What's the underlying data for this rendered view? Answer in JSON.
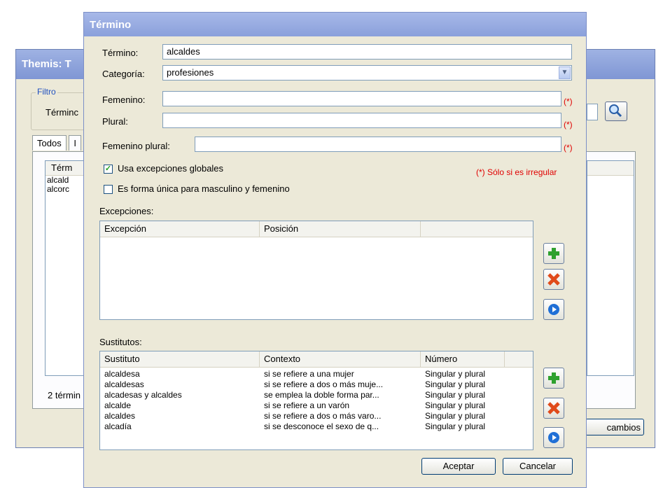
{
  "background_window": {
    "title": "Themis: T",
    "filter_legend": "Filtro",
    "filter_label": "Términc",
    "tabs": [
      "Todos",
      "I"
    ],
    "list_header": "Térm",
    "list_rows": [
      "alcald",
      "alcorc"
    ],
    "count": "2 términ",
    "changes_button": "cambios"
  },
  "dialog": {
    "title": "Término",
    "termino_label": "Término:",
    "termino_value": "alcaldes",
    "categoria_label": "Categoría:",
    "categoria_value": "profesiones",
    "femenino_label": "Femenino:",
    "femenino_value": "",
    "plural_label": "Plural:",
    "plural_value": "",
    "femenino_plural_label": "Femenino plural:",
    "femenino_plural_value": "",
    "required_marker": "(*)",
    "checkbox_excepciones_globales": {
      "label": "Usa excepciones globales",
      "checked": true
    },
    "checkbox_forma_unica": {
      "label": "Es forma única para masculino y femenino",
      "checked": false
    },
    "irregular_note": "(*) Sólo si es irregular",
    "excepciones_label": "Excepciones:",
    "excepciones_columns": [
      "Excepción",
      "Posición"
    ],
    "sustitutos_label": "Sustitutos:",
    "sustitutos_columns": [
      "Sustituto",
      "Contexto",
      "Número"
    ],
    "sustitutos_rows": [
      [
        "alcaldesa",
        "si se refiere a una mujer",
        "Singular y plural"
      ],
      [
        "alcaldesas",
        "si se refiere a dos o más muje...",
        "Singular y plural"
      ],
      [
        "alcadesas y alcaldes",
        "se emplea la doble forma par...",
        "Singular y plural"
      ],
      [
        "alcalde",
        "si se refiere a un varón",
        "Singular y plural"
      ],
      [
        "alcaldes",
        "si se refiere a dos o más varo...",
        "Singular y plural"
      ],
      [
        "alcadía",
        "si se desconoce el sexo de q...",
        "Singular y plural"
      ]
    ],
    "aceptar_label": "Aceptar",
    "cancelar_label": "Cancelar"
  },
  "icons": [
    "add-icon",
    "delete-icon",
    "details-icon",
    "search-icon",
    "dropdown-arrow-icon",
    "checkmark-icon"
  ],
  "colors": {
    "required_red": "#e00000",
    "title_bar": "#8aa0db",
    "dialog_bg": "#ece9d8",
    "add_green": "#2fa12f",
    "delete_red": "#e04a1a",
    "details_blue": "#1f6fd6"
  }
}
